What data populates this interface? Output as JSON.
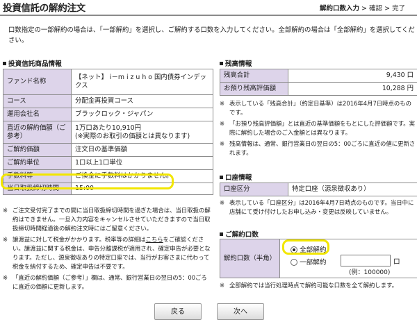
{
  "header": {
    "title": "投資信託の解約注文",
    "steps": [
      "解約口数入力",
      "確認",
      "完了"
    ],
    "step_sep": ">"
  },
  "intro": [
    "口数指定の一部解約の場合は、「一部解約」を選択し、ご解約する口数を入力してください。全部解約の場合は「全部解約」を選択してくだ",
    "さい。"
  ],
  "product": {
    "heading": "投資信託商品情報",
    "rows": [
      {
        "label": "ファンド名称",
        "value": "【ネット】 i－m i z u h o 国内債券インデックス"
      },
      {
        "label": "コース",
        "value": "分配金再投資コース"
      },
      {
        "label": "運用会社名",
        "value": "ブラックロック・ジャパン"
      },
      {
        "label": "直近の解約価額（ご参考）",
        "value": "1万口あたり10,910円",
        "value2": "(※実際のお取引の価額とは異なります)"
      },
      {
        "label": "ご解約価額",
        "value": "注文日の基準価額"
      },
      {
        "label": "ご解約単位",
        "value": "1口以上1口単位"
      },
      {
        "label": "手数料等",
        "value": "ご換金に手数料はかかりません。"
      },
      {
        "label": "当日取扱締切時間",
        "value": "15:00"
      }
    ],
    "notes": [
      "ご注文受付完了までの間に当日取扱締切時間を過ぎた場合は、当日取扱の解約はできません。一旦入力内容をキャンセルさせていただきますので当日取扱締切時間経過後の解約注文時にはご留意ください。",
      "譲渡益に対して税金がかかります。税率等の詳細はこちらをご確認ください。譲渡益に関する税金は、申告分離課税が適用され、確定申告が必要となります。ただし、源泉徴収ありの特定口座では、当行がお客さまに代わって税金を納付するため、確定申告は不要です。",
      "「直近の解約価額（ご参考）」欄は、通常、銀行営業日の翌日の5：00ごろに直近の価額に更新します。"
    ],
    "link_text": "こちら"
  },
  "balance": {
    "heading": "残高情報",
    "rows": [
      {
        "label": "残高合計",
        "value": "9,430 口"
      },
      {
        "label": "お預り残高評価額",
        "value": "10,288 円"
      }
    ],
    "notes": [
      "表示している「残高合計」（約定日基準）は2016年4月7日時点のものです。",
      "「お預り残高評価額」とは直近の基準価額をもとにした評価額です。実際に解約した場合のご入金額とは異なります。",
      "残高情報は、通常、銀行営業日の翌日の5：00ごろに直近の値に更新されます。"
    ]
  },
  "account": {
    "heading": "口座情報",
    "label": "口座区分",
    "value": "特定口座（源泉徴収あり）",
    "note": "表示している「口座区分」は2016年4月7日時点のものです。当日中に店舗にて受け付けしたお申し込み・変更は反映していません。"
  },
  "redeem": {
    "heading": "ご解約口数",
    "label": "解約口数（半角）",
    "option_all": "全部解約",
    "option_part": "一部解約",
    "unit": "口",
    "example": "(例：100000)",
    "input_value": "",
    "note": "全部解約では当行処理時点で解約可能な口数を全て解約します。"
  },
  "buttons": {
    "back": "戻る",
    "next": "次へ"
  },
  "colors": {
    "label_bg": "#ddd4ea",
    "highlight": "#f2e600"
  }
}
